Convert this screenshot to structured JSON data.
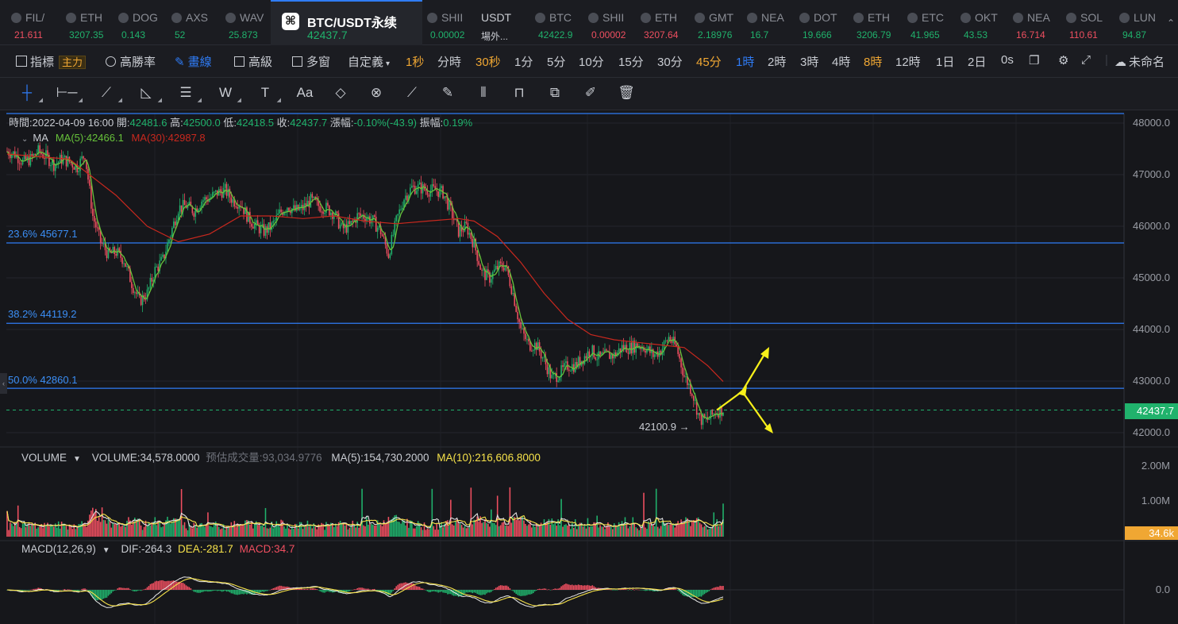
{
  "ticker": [
    {
      "name": "FIL/",
      "price": "21.611",
      "up": false
    },
    {
      "name": "ETH",
      "price": "3207.35",
      "up": true
    },
    {
      "name": "DOG",
      "price": "0.143",
      "up": true
    },
    {
      "name": "AXS",
      "price": "52",
      "up": true
    },
    {
      "name": "WAV",
      "price": "25.873",
      "up": true
    },
    {
      "name": "BTC/USDT永续",
      "price": "42437.7",
      "up": true,
      "active": true
    },
    {
      "name": "SHII",
      "price": "0.00002",
      "up": true
    },
    {
      "name": "USDT",
      "price": "場外...",
      "up": true,
      "usdt": true
    },
    {
      "name": "BTC",
      "price": "42422.9",
      "up": true
    },
    {
      "name": "SHII",
      "price": "0.00002",
      "up": false
    },
    {
      "name": "ETH",
      "price": "3207.64",
      "up": false
    },
    {
      "name": "GMT",
      "price": "2.18976",
      "up": true
    },
    {
      "name": "NEA",
      "price": "16.7",
      "up": true
    },
    {
      "name": "DOT",
      "price": "19.666",
      "up": true
    },
    {
      "name": "ETH",
      "price": "3206.79",
      "up": true
    },
    {
      "name": "ETC",
      "price": "41.965",
      "up": true
    },
    {
      "name": "OKT",
      "price": "43.53",
      "up": true
    },
    {
      "name": "NEA",
      "price": "16.714",
      "up": false
    },
    {
      "name": "SOL",
      "price": "110.61",
      "up": false
    },
    {
      "name": "LUN",
      "price": "94.87",
      "up": true
    }
  ],
  "toolbar": {
    "indicator": "指標",
    "main_badge": "主力",
    "win_rate": "高勝率",
    "draw": "畫線",
    "advanced": "高級",
    "multi_window": "多窗",
    "custom": "自定義",
    "intervals": [
      "1秒",
      "分時",
      "30秒",
      "1分",
      "5分",
      "10分",
      "15分",
      "30分",
      "45分",
      "1時",
      "2時",
      "3時",
      "4時",
      "8時",
      "12時",
      "1日",
      "2日",
      "0s"
    ],
    "unnamed": "未命名"
  },
  "drawing_tools": [
    "crosshair-icon",
    "horizontal-line-icon",
    "trend-lines-icon",
    "angle-icon",
    "parallel-channel-icon",
    "wave-icon",
    "text-tool-icon",
    "font-icon",
    "eraser-icon",
    "magnet-icon",
    "ruler-icon",
    "brush-icon",
    "candles-icon",
    "lock-icon",
    "copy-icon",
    "edit-icon",
    "trash-icon"
  ],
  "font_tool_label": "Aa",
  "info": {
    "time_label": "時間:",
    "time": "2022-04-09 16:00",
    "open_label": "開:",
    "open": "42481.6",
    "high_label": "高:",
    "high": "42500.0",
    "low_label": "低:",
    "low": "42418.5",
    "close_label": "收:",
    "close": "42437.7",
    "change_label": "漲幅:",
    "change": "-0.10%(-43.9)",
    "amp_label": "振幅:",
    "amp": "0.19%"
  },
  "ma": {
    "label": "MA",
    "ma5": "MA(5):42466.1",
    "ma30": "MA(30):42987.8"
  },
  "fib_levels": [
    {
      "label": "23.6% 45677.1",
      "price": 45677.1
    },
    {
      "label": "38.2% 44119.2",
      "price": 44119.2
    },
    {
      "label": "50.0% 42860.1",
      "price": 42860.1
    }
  ],
  "price_axis": [
    "48000.0",
    "47000.0",
    "46000.0",
    "45000.0",
    "44000.0",
    "43000.0",
    "42000.0"
  ],
  "current_price": "42437.7",
  "low_marker": "42100.9 →",
  "volume": {
    "label": "VOLUME",
    "value": "VOLUME:34,578.0000",
    "est_label": "预估成交量:",
    "est": "93,034.9776",
    "ma5": "MA(5):154,730.2000",
    "ma10": "MA(10):216,606.8000",
    "axis": [
      "2.00M",
      "1.00M"
    ],
    "current": "34.6k"
  },
  "macd": {
    "label": "MACD(12,26,9)",
    "dif": "DIF:-264.3",
    "dea": "DEA:-281.7",
    "macd": "MACD:34.7",
    "axis": "0.0"
  },
  "colors": {
    "up": "#20b26c",
    "down": "#ef4f60",
    "ma5": "#67c23a",
    "ma30": "#c8281e",
    "fib": "#3b8ef5",
    "arrows": "#f7f01a",
    "accent": "#2f7cf6",
    "orange": "#f0a733"
  },
  "chart_data": {
    "type": "candlestick",
    "timeframe": "1時",
    "last_candle": {
      "time": "2022-04-09 16:00",
      "open": 42481.6,
      "high": 42500.0,
      "low": 42418.5,
      "close": 42437.7
    },
    "price_axis_range": [
      41900,
      48100
    ],
    "price_ticks": [
      42000,
      43000,
      44000,
      45000,
      46000,
      47000,
      48000
    ],
    "close_path": [
      [
        0,
        47450
      ],
      [
        5,
        47400
      ],
      [
        10,
        47250
      ],
      [
        15,
        47300
      ],
      [
        20,
        47450
      ],
      [
        25,
        47350
      ],
      [
        30,
        47200
      ],
      [
        35,
        47300
      ],
      [
        40,
        47250
      ],
      [
        45,
        47150
      ],
      [
        50,
        47400
      ],
      [
        55,
        46200
      ],
      [
        60,
        45700
      ],
      [
        65,
        45450
      ],
      [
        70,
        45500
      ],
      [
        75,
        45350
      ],
      [
        80,
        44900
      ],
      [
        85,
        44550
      ],
      [
        90,
        44700
      ],
      [
        95,
        45150
      ],
      [
        100,
        45350
      ],
      [
        105,
        45850
      ],
      [
        110,
        46350
      ],
      [
        115,
        46400
      ],
      [
        120,
        46300
      ],
      [
        125,
        46500
      ],
      [
        130,
        46550
      ],
      [
        135,
        46650
      ],
      [
        140,
        46700
      ],
      [
        145,
        46500
      ],
      [
        150,
        46450
      ],
      [
        155,
        46150
      ],
      [
        160,
        46000
      ],
      [
        165,
        45900
      ],
      [
        170,
        46000
      ],
      [
        175,
        46250
      ],
      [
        180,
        46400
      ],
      [
        185,
        46300
      ],
      [
        190,
        46350
      ],
      [
        195,
        46500
      ],
      [
        200,
        46400
      ],
      [
        205,
        46350
      ],
      [
        210,
        46250
      ],
      [
        215,
        45950
      ],
      [
        220,
        46000
      ],
      [
        225,
        46200
      ],
      [
        230,
        46200
      ],
      [
        235,
        46100
      ],
      [
        240,
        45900
      ],
      [
        245,
        45450
      ],
      [
        250,
        46100
      ],
      [
        255,
        46550
      ],
      [
        260,
        46750
      ],
      [
        265,
        46750
      ],
      [
        270,
        46700
      ],
      [
        275,
        46700
      ],
      [
        280,
        46650
      ],
      [
        285,
        46300
      ],
      [
        290,
        45900
      ],
      [
        295,
        46000
      ],
      [
        300,
        45650
      ],
      [
        305,
        45100
      ],
      [
        310,
        45000
      ],
      [
        315,
        45200
      ],
      [
        320,
        45250
      ],
      [
        325,
        44700
      ],
      [
        330,
        44000
      ],
      [
        335,
        43700
      ],
      [
        340,
        43700
      ],
      [
        345,
        43400
      ],
      [
        350,
        43050
      ],
      [
        355,
        43150
      ],
      [
        360,
        43300
      ],
      [
        365,
        43300
      ],
      [
        370,
        43450
      ],
      [
        375,
        43600
      ],
      [
        380,
        43450
      ],
      [
        385,
        43500
      ],
      [
        390,
        43500
      ],
      [
        395,
        43650
      ],
      [
        400,
        43650
      ],
      [
        405,
        43700
      ],
      [
        410,
        43650
      ],
      [
        415,
        43500
      ],
      [
        420,
        43600
      ],
      [
        425,
        43850
      ],
      [
        430,
        43650
      ],
      [
        435,
        43100
      ],
      [
        440,
        42800
      ],
      [
        445,
        42250
      ],
      [
        450,
        42250
      ],
      [
        455,
        42400
      ],
      [
        460,
        42450
      ]
    ],
    "ma30_path": [
      [
        0,
        47400
      ],
      [
        40,
        47300
      ],
      [
        70,
        46600
      ],
      [
        90,
        46000
      ],
      [
        110,
        45700
      ],
      [
        130,
        45850
      ],
      [
        150,
        46200
      ],
      [
        170,
        46200
      ],
      [
        190,
        46150
      ],
      [
        210,
        46200
      ],
      [
        230,
        46100
      ],
      [
        250,
        46050
      ],
      [
        270,
        46100
      ],
      [
        290,
        46150
      ],
      [
        300,
        46100
      ],
      [
        315,
        45800
      ],
      [
        330,
        45300
      ],
      [
        345,
        44700
      ],
      [
        360,
        44200
      ],
      [
        375,
        43900
      ],
      [
        390,
        43800
      ],
      [
        405,
        43750
      ],
      [
        420,
        43700
      ],
      [
        435,
        43650
      ],
      [
        450,
        43300
      ],
      [
        460,
        42990
      ]
    ],
    "fib_levels": [
      45677.1,
      44119.2,
      42860.1
    ],
    "current_price": 42437.7,
    "marked_low": 42100.9,
    "volume": {
      "ma5": 154730.2,
      "ma10": 216606.8,
      "last": 34578.0,
      "estimated": 93034.9776,
      "axis_ticks": [
        2000000,
        1000000
      ]
    },
    "macd": {
      "dif": -264.3,
      "dea": -281.7,
      "hist": 34.7,
      "params": [
        12,
        26,
        9
      ]
    }
  }
}
